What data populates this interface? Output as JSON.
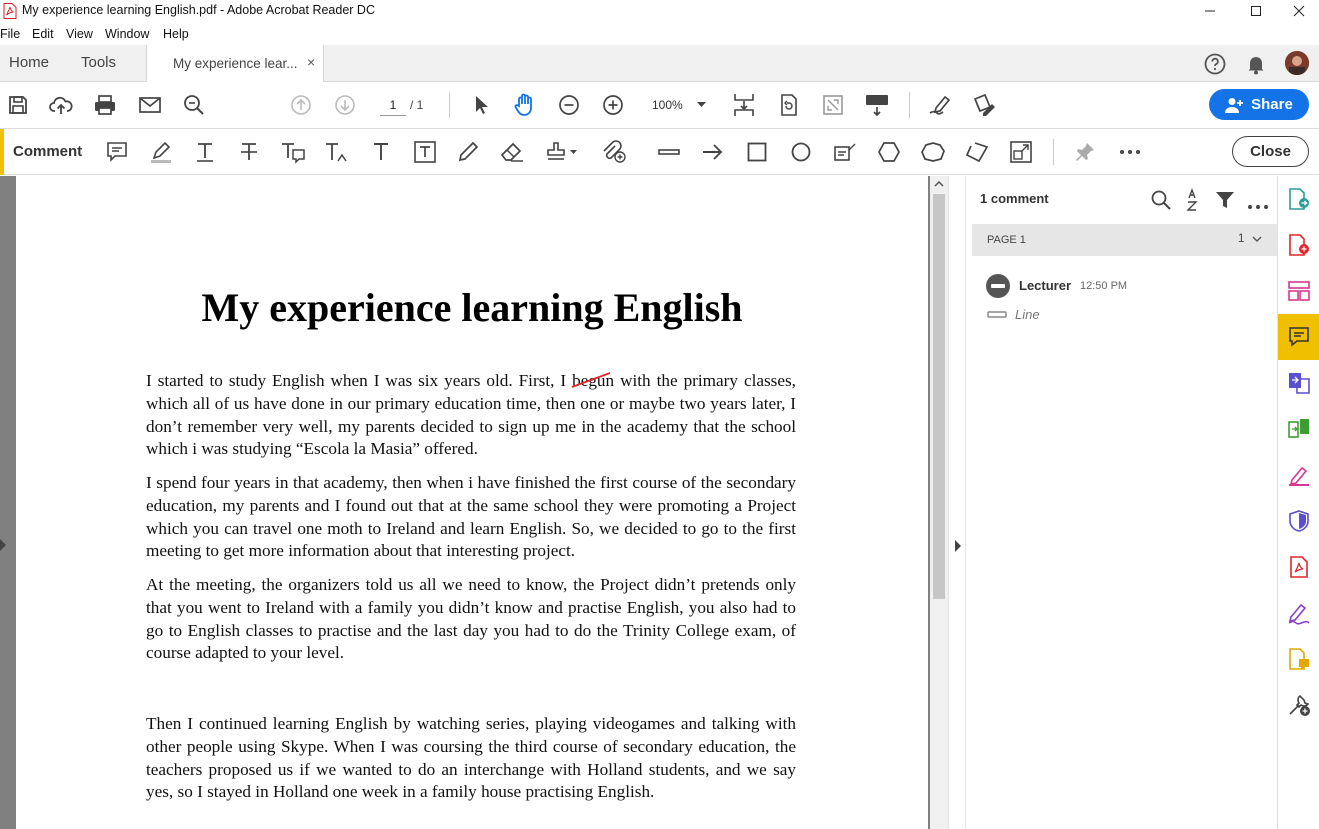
{
  "window": {
    "title": "My experience learning English.pdf - Adobe Acrobat Reader DC"
  },
  "menu": {
    "file": "File",
    "edit": "Edit",
    "view": "View",
    "window": "Window",
    "help": "Help"
  },
  "tabs": {
    "home": "Home",
    "tools": "Tools",
    "document": "My experience lear...",
    "close_glyph": "×"
  },
  "toolbar": {
    "page_current": "1",
    "page_total": "/ 1",
    "zoom": "100%",
    "share_label": "Share"
  },
  "comment_toolbar": {
    "label": "Comment",
    "close_label": "Close"
  },
  "document": {
    "title": "My experience learning English",
    "p1_before": "I started to study English when I was six years old. First, I ",
    "p1_struck": "begun",
    "p1_after": " with the primary classes, which all of us have done in our primary education time, then one or maybe two years later, I don’t remember very well, my parents decided to sign up me in the academy that the school which i was studying “Escola la Masia” offered.",
    "p2": "I spend four years in that academy, then when i have finished the first course of the secondary education, my parents and I found out that at the same school they were promoting a Project which you can travel one moth to Ireland and learn English. So, we decided to go to the first meeting to get more information about that interesting project.",
    "p3": "At the meeting, the organizers told us all we need to know, the Project didn’t pretends only that you went to Ireland with a family you didn’t know and practise English, you also had to go to English classes to practise and the last day you had to do the Trinity College exam, of course adapted to your level.",
    "p4": "Then I continued learning English by watching series, playing videogames and talking with other people using Skype. When I was coursing the third course of secondary education, the teachers proposed us if we wanted to do an interchange with Holland students, and we say yes, so I stayed in Holland one week in a family house practising English."
  },
  "comments_panel": {
    "count_label": "1 comment",
    "page_group": "PAGE 1",
    "page_count": "1",
    "items": [
      {
        "author": "Lecturer",
        "time": "12:50 PM",
        "type": "Line"
      }
    ]
  },
  "colors": {
    "accent_yellow": "#f0c000",
    "share_blue": "#1473e6",
    "markup_red": "#e0262b"
  }
}
